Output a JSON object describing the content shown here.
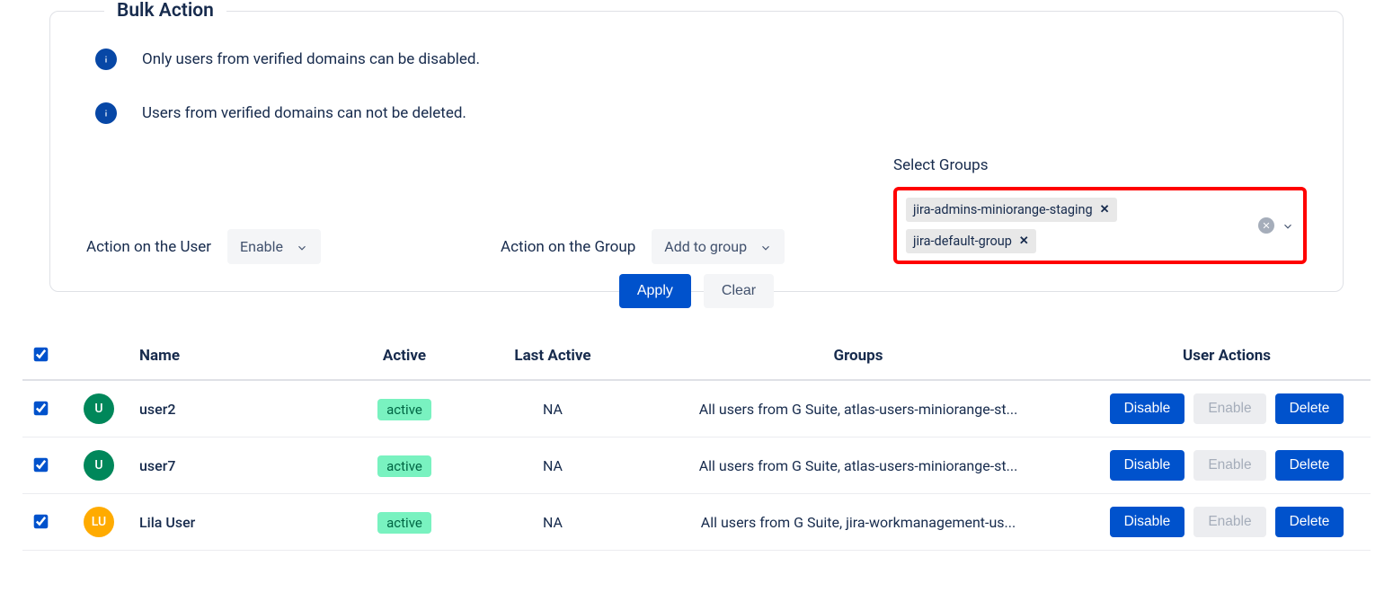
{
  "bulk": {
    "legend": "Bulk Action",
    "info1": "Only users from verified domains can be disabled.",
    "info2": "Users from verified domains can not be deleted.",
    "actionUserLabel": "Action on the User",
    "actionUserValue": "Enable",
    "actionGroupLabel": "Action on the Group",
    "actionGroupValue": "Add to group",
    "selectGroupsLabel": "Select Groups",
    "tags": [
      "jira-admins-miniorange-staging",
      "jira-default-group"
    ],
    "applyLabel": "Apply",
    "clearLabel": "Clear"
  },
  "table": {
    "headers": {
      "name": "Name",
      "active": "Active",
      "lastActive": "Last Active",
      "groups": "Groups",
      "userActions": "User Actions"
    },
    "rows": [
      {
        "initials": "U",
        "avatarClass": "av-green",
        "name": "user2",
        "activeLabel": "active",
        "lastActive": "NA",
        "groups": "All users from G Suite, atlas-users-miniorange-st..."
      },
      {
        "initials": "U",
        "avatarClass": "av-green",
        "name": "user7",
        "activeLabel": "active",
        "lastActive": "NA",
        "groups": "All users from G Suite, atlas-users-miniorange-st..."
      },
      {
        "initials": "LU",
        "avatarClass": "av-orange",
        "name": "Lila User",
        "activeLabel": "active",
        "lastActive": "NA",
        "groups": "All users from G Suite, jira-workmanagement-us..."
      }
    ],
    "actionLabels": {
      "disable": "Disable",
      "enable": "Enable",
      "delete": "Delete"
    }
  }
}
